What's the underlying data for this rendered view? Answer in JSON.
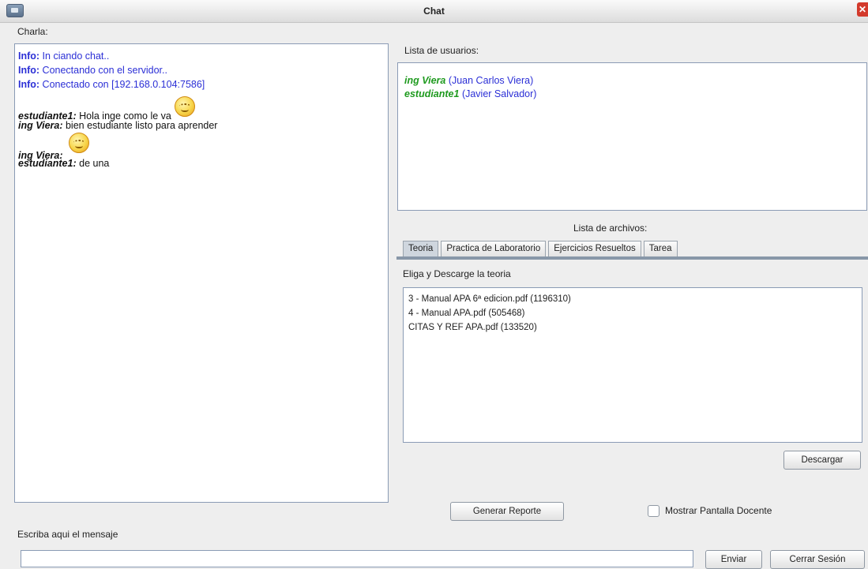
{
  "window": {
    "title": "Chat"
  },
  "chat": {
    "label": "Charla:",
    "messages": [
      {
        "kind": "info",
        "prefix": "Info:",
        "text": " In ciando chat.."
      },
      {
        "kind": "info",
        "prefix": "Info:",
        "text": " Conectando con el servidor.."
      },
      {
        "kind": "info",
        "prefix": "Info:",
        "text": " Conectado con [192.168.0.104:7586]"
      },
      {
        "kind": "user",
        "prefix": "estudiante1:",
        "text": " Hola inge como le va",
        "emoji": "smiley-emoji"
      },
      {
        "kind": "user",
        "prefix": "ing Viera:",
        "text": " bien estudiante listo para aprender"
      },
      {
        "kind": "user",
        "prefix": "ing Viera:",
        "text": " ",
        "emoji": "smiley-emoji"
      },
      {
        "kind": "user",
        "prefix": "estudiante1:",
        "text": " de una"
      }
    ]
  },
  "users": {
    "label": "Lista de usuarios:",
    "items": [
      {
        "nick": "ing Viera",
        "full": " (Juan Carlos Viera)"
      },
      {
        "nick": "estudiante1",
        "full": " (Javier Salvador)"
      }
    ]
  },
  "files": {
    "label": "Lista de archivos:",
    "tabs": [
      "Teoria",
      "Practica de Laboratorio",
      "Ejercicios Resueltos",
      "Tarea"
    ],
    "active_tab": "Teoria",
    "instruction": "Eliga y Descarge la teoria",
    "items": [
      "3 - Manual APA 6ª edicion.pdf (1196310)",
      "4 - Manual APA.pdf (505468)",
      "CITAS Y REF APA.pdf (133520)"
    ],
    "download_label": "Descargar"
  },
  "actions": {
    "report_label": "Generar Reporte",
    "show_screen_label": "Mostrar Pantalla Docente",
    "show_screen_checked": false
  },
  "composer": {
    "label": "Escriba aqui el mensaje",
    "value": "",
    "send_label": "Enviar",
    "logout_label": "Cerrar Sesión"
  }
}
